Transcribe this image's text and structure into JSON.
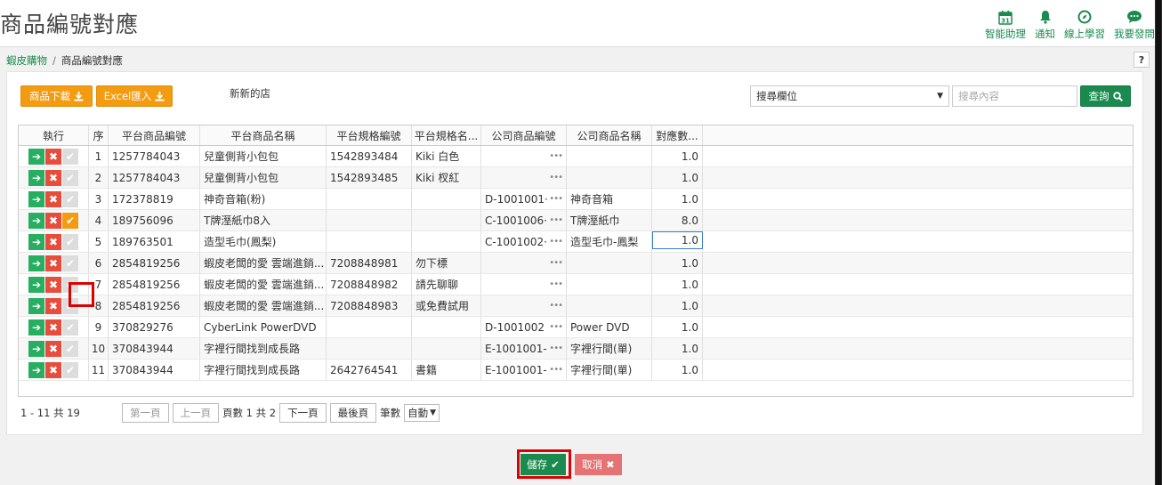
{
  "page": {
    "title": "商品編號對應"
  },
  "topnav": [
    {
      "label": "智能助理",
      "icon": "calendar-icon",
      "badge": "31"
    },
    {
      "label": "通知",
      "icon": "bell-icon"
    },
    {
      "label": "線上學習",
      "icon": "compass-icon"
    },
    {
      "label": "我要發問",
      "icon": "chat-icon"
    }
  ],
  "breadcrumb": {
    "root": "蝦皮購物",
    "current": "商品編號對應"
  },
  "help": "?",
  "toolbar": {
    "download_label": "商品下載",
    "excel_label": "Excel匯入",
    "store_name": "新新的店",
    "search_field_selected": "搜尋欄位",
    "search_placeholder": "搜尋內容",
    "query_label": "查詢"
  },
  "grid": {
    "headers": [
      "執行",
      "序",
      "平台商品編號",
      "平台商品名稱",
      "平台規格編號",
      "平台規格名...",
      "公司商品編號",
      "公司商品名稱",
      "對應數..."
    ],
    "rows": [
      {
        "seq": "1",
        "pid": "1257784043",
        "pname": "兒童側背小包包",
        "sid": "1542893484",
        "sname": "Kiki 白色",
        "cid": "",
        "cname": "",
        "qty": "1.0",
        "checked": false
      },
      {
        "seq": "2",
        "pid": "1257784043",
        "pname": "兒童側背小包包",
        "sid": "1542893485",
        "sname": "Kiki 杈紅",
        "cid": "",
        "cname": "",
        "qty": "1.0",
        "checked": false
      },
      {
        "seq": "3",
        "pid": "172378819",
        "pname": "神奇音箱(粉)",
        "sid": "",
        "sname": "",
        "cid": "D-1001001·",
        "cname": "神奇音箱",
        "qty": "1.0",
        "checked": false
      },
      {
        "seq": "4",
        "pid": "189756096",
        "pname": "T牌溼紙巾8入",
        "sid": "",
        "sname": "",
        "cid": "C-1001006·",
        "cname": "T牌溼紙巾",
        "qty": "8.0",
        "checked": true
      },
      {
        "seq": "5",
        "pid": "189763501",
        "pname": "造型毛巾(鳳梨)",
        "sid": "",
        "sname": "",
        "cid": "C-1001002·",
        "cname": "造型毛巾-鳳梨",
        "qty": "1.0",
        "checked": false
      },
      {
        "seq": "6",
        "pid": "2854819256",
        "pname": "蝦皮老闆的愛 雲端進銷...",
        "sid": "7208848981",
        "sname": "勿下標",
        "cid": "",
        "cname": "",
        "qty": "1.0",
        "checked": false
      },
      {
        "seq": "7",
        "pid": "2854819256",
        "pname": "蝦皮老闆的愛 雲端進銷...",
        "sid": "7208848982",
        "sname": "請先聊聊",
        "cid": "",
        "cname": "",
        "qty": "1.0",
        "checked": false
      },
      {
        "seq": "8",
        "pid": "2854819256",
        "pname": "蝦皮老闆的愛 雲端進銷...",
        "sid": "7208848983",
        "sname": "或免費試用",
        "cid": "",
        "cname": "",
        "qty": "1.0",
        "checked": false
      },
      {
        "seq": "9",
        "pid": "370829276",
        "pname": "CyberLink PowerDVD",
        "sid": "",
        "sname": "",
        "cid": "D-1001002",
        "cname": "Power DVD",
        "qty": "1.0",
        "checked": false
      },
      {
        "seq": "10",
        "pid": "370843944",
        "pname": "字裡行間找到成長路",
        "sid": "",
        "sname": "",
        "cid": "E-1001001-",
        "cname": "字裡行間(單)",
        "qty": "1.0",
        "checked": false
      },
      {
        "seq": "11",
        "pid": "370843944",
        "pname": "字裡行間找到成長路",
        "sid": "2642764541",
        "sname": "書籍",
        "cid": "E-1001001-",
        "cname": "字裡行間(單)",
        "qty": "1.0",
        "checked": false
      }
    ]
  },
  "pager": {
    "range": "1 - 11 共 19",
    "first": "第一頁",
    "prev": "上一頁",
    "page_info": "頁數 1 共 2",
    "next": "下一頁",
    "last": "最後頁",
    "size_label": "筆數",
    "size_value": "自動"
  },
  "footer": {
    "save_label": "儲存",
    "cancel_label": "取消"
  },
  "colors": {
    "brand_green": "#1a8a4e",
    "orange": "#f39c12",
    "danger": "#e74c3c",
    "highlight": "#dd0000"
  }
}
